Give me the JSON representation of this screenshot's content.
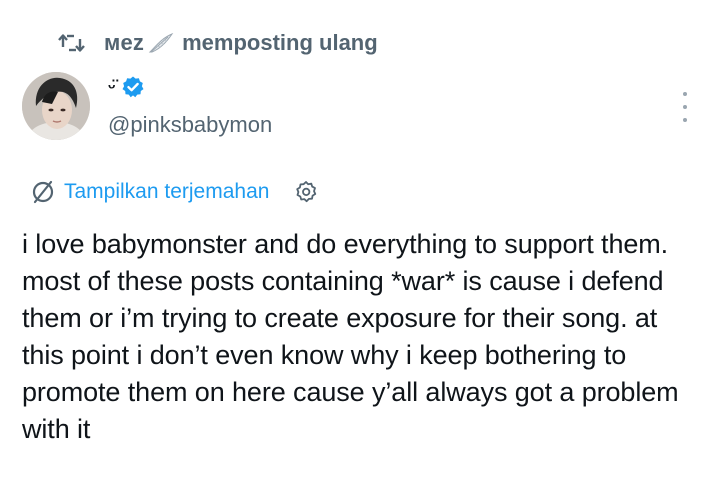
{
  "repost": {
    "user": "мez",
    "label": "memposting ulang"
  },
  "author": {
    "display_name": "ᵕ̈",
    "handle": "@pinksbabymon",
    "verified": true
  },
  "translate": {
    "label": "Tampilkan terjemahan"
  },
  "tweet": {
    "text": "i love babymonster and do everything to support them. most of these posts containing *war* is cause i defend them or i’m trying to create exposure for their song. at this point i don’t even know why i keep bothering to promote them on here cause y’all always got a problem with it"
  },
  "colors": {
    "text_primary": "#0f1419",
    "text_secondary": "#536471",
    "accent_blue": "#1d9bf0"
  },
  "icons": [
    "repost-icon",
    "feather-icon",
    "verified-icon",
    "more-icon",
    "translate-icon",
    "settings-icon"
  ]
}
